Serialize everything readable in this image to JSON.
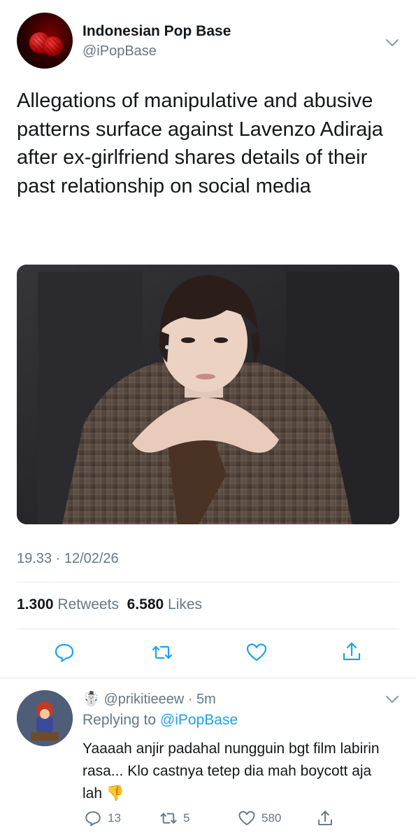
{
  "tweet": {
    "display_name": "Indonesian Pop Base",
    "handle": "@iPopBase",
    "text": "Allegations of manipulative and abusive patterns surface against Lavenzo Adiraja after ex-girlfriend shares details of their past relationship on social media",
    "timestamp": "19.33 · 12/02/26",
    "retweets_count": "1.300",
    "retweets_label": "Retweets",
    "likes_count": "6.580",
    "likes_label": "Likes"
  },
  "icons": {
    "caret": "chevron-down-icon",
    "reply": "reply-icon",
    "retweet": "retweet-icon",
    "like": "heart-icon",
    "share": "share-icon"
  },
  "reply": {
    "emoji": "☃️",
    "handle": "@prikitieeew",
    "time": "· 5m",
    "replying_prefix": "Replying to",
    "replying_handle": "@iPopBase",
    "text": "Yaaaah anjir padahal nungguin bgt film labirin rasa... Klo castnya tetep dia mah boycott aja lah",
    "text_emoji": "👎",
    "reply_count": "13",
    "retweet_count": "5",
    "like_count": "580"
  },
  "colors": {
    "accent": "#1da1f2",
    "secondary_text": "#657786",
    "primary_text": "#14171a",
    "divider": "#e1e8ed"
  }
}
